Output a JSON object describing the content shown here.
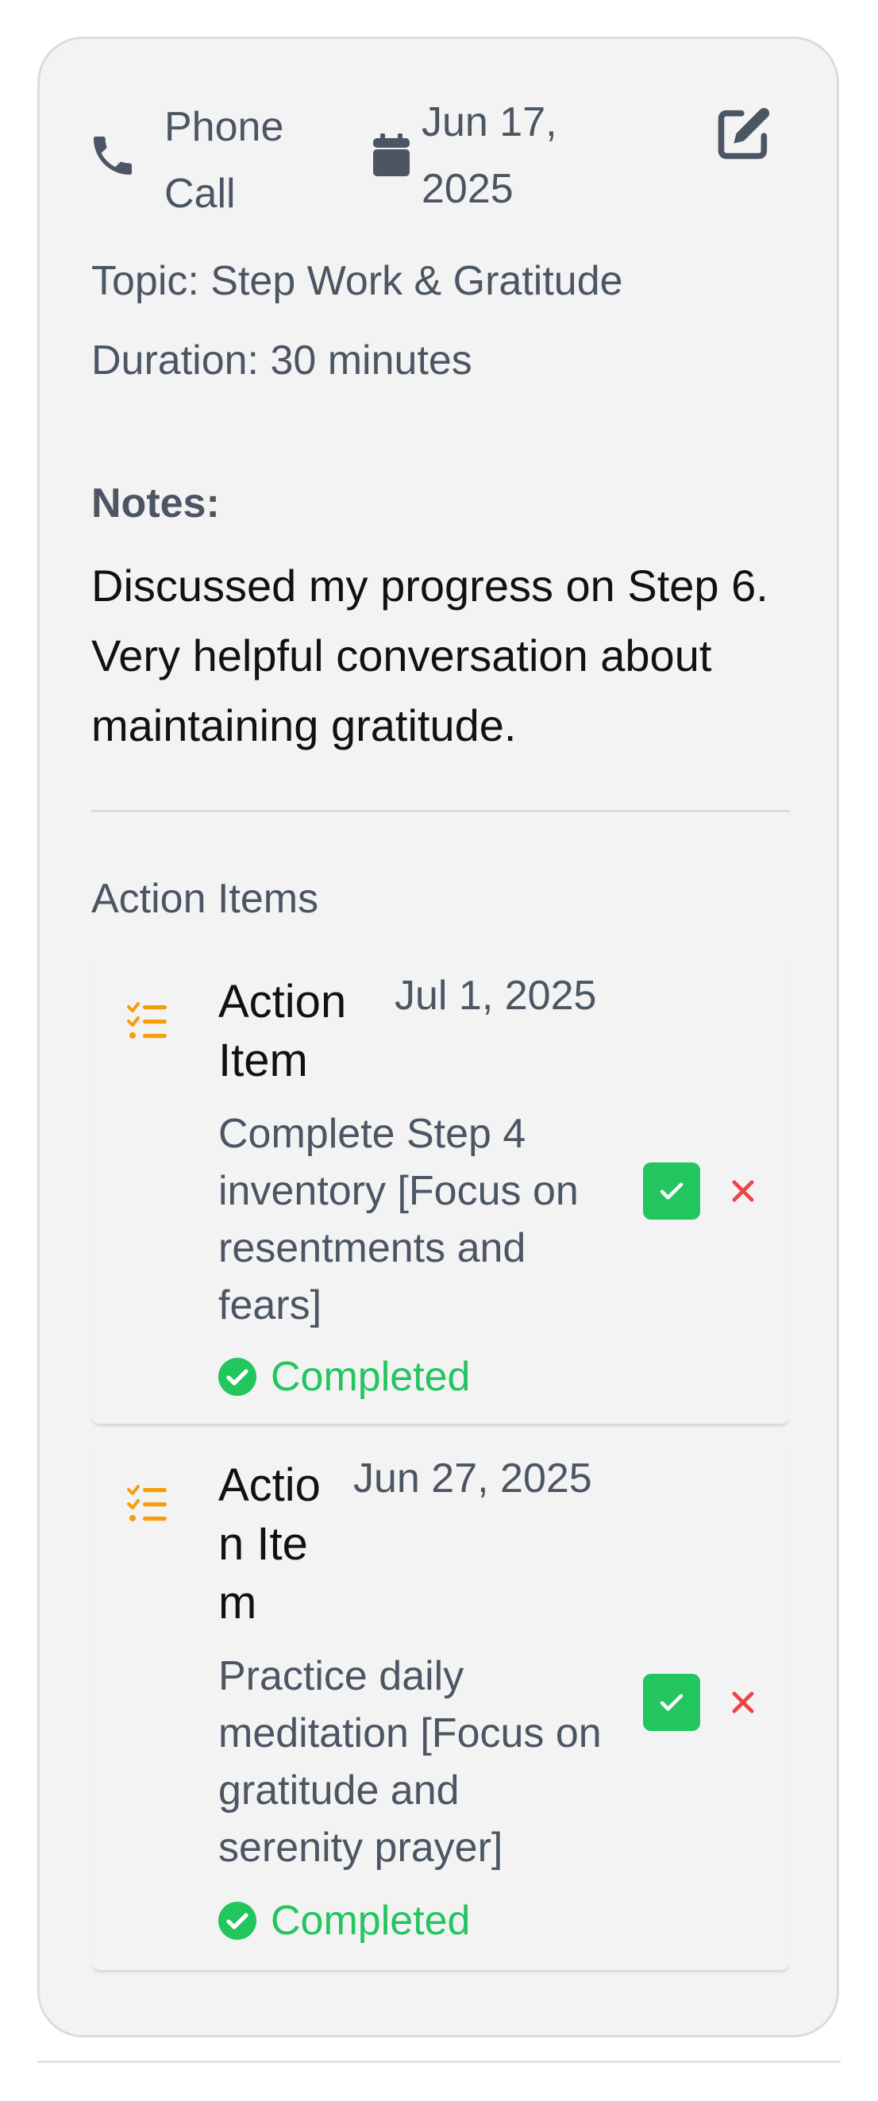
{
  "meeting": {
    "type": "Phone Call",
    "date": "Jun 17, 2025",
    "topic": "Topic: Step Work & Gratitude",
    "duration": "Duration: 30 minutes",
    "notes_label": "Notes:",
    "notes": "Discussed my progress on Step 6. Very helpful conversation about maintaining gratitude."
  },
  "action_items_title": "Action Items",
  "action_items": [
    {
      "title": "Action Item",
      "date": "Jul 1, 2025",
      "description": "Complete Step 4 inventory [Focus on resentments and fears]",
      "status": "Completed"
    },
    {
      "title": "Action Item",
      "date": "Jun 27, 2025",
      "description": "Practice daily meditation [Focus on gratitude and serenity prayer]",
      "status": "Completed"
    }
  ],
  "colors": {
    "card_background": "#f3f3f4",
    "text_secondary": "#4b5563",
    "text_primary": "#111111",
    "accent_orange": "#f59e0b",
    "success_green": "#22c55e",
    "danger_red": "#ef4444"
  },
  "icons": {
    "meeting_type": "phone-icon",
    "date": "calendar-icon",
    "edit": "edit-icon",
    "action_item": "list-check-icon",
    "status": "check-circle-icon",
    "complete": "check-icon",
    "delete": "close-icon"
  }
}
